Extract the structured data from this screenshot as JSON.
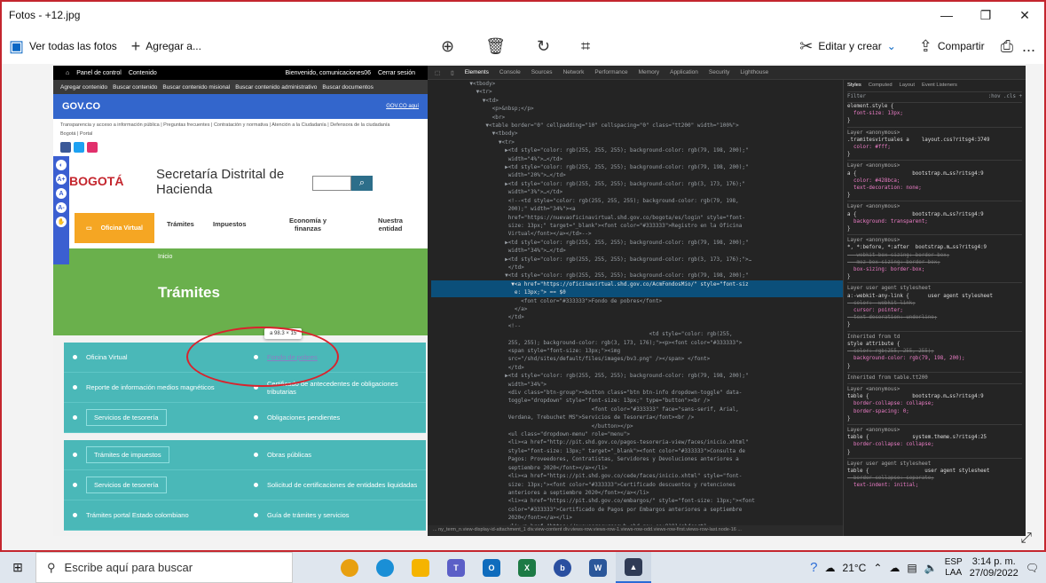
{
  "window": {
    "title": "Fotos - +12.jpg",
    "minimize": "—",
    "maximize": "❐",
    "close": "✕"
  },
  "toolbar": {
    "see_all": "Ver todas las fotos",
    "add": "Agregar a...",
    "edit": "Editar y crear",
    "share": "Compartir",
    "more": "..."
  },
  "site": {
    "topbar": {
      "panel": "Panel de control",
      "contenido": "Contenido",
      "welcome": "Bienvenido, comunicaciones06",
      "logout": "Cerrar sesión"
    },
    "menubar": [
      "Agregar contenido",
      "Buscar contenido",
      "Buscar contenido misional",
      "Buscar contenido administrativo",
      "Buscar documentos"
    ],
    "gov_logo": "GOV.CO",
    "gov_link": "GOV.CO aquí",
    "transparency": "Transparencia y acceso a información pública | Preguntas frecuentes | Contratación y normativa | Atención a la Ciudadanía | Defensora de la ciudadanía",
    "sub_links": "Bogotá | Portal",
    "logo": "BOGOTÁ",
    "secretaria_1": "Secretaría Distrital de",
    "secretaria_2": "Hacienda",
    "nav": {
      "oficina": "Oficina Virtual",
      "tramites": "Trámites",
      "impuestos": "Impuestos",
      "economia": "Economía y finanzas",
      "entidad": "Nuestra entidad"
    },
    "breadcrumb": "Inicio",
    "page_title": "Trámites",
    "tooltip": "a  98.3 × 15",
    "rows_top": [
      [
        "Oficina Virtual",
        "Fondo de pobres"
      ],
      [
        "Reporte de información medios magnéticos",
        "Certificado de antecedentes de obligaciones tributarias"
      ],
      [
        "Servicios de tesorería",
        "Obligaciones pendientes"
      ]
    ],
    "rows_bottom": [
      [
        "Trámites de impuestos",
        "Obras públicas"
      ],
      [
        "Servicios de tesorería",
        "Solicitud de certificaciones de entidades liquidadas"
      ],
      [
        "Trámites portal Estado colombiano",
        "Guía de trámites y servicios"
      ]
    ]
  },
  "devtools": {
    "tabs": [
      "Elements",
      "Console",
      "Sources",
      "Network",
      "Performance",
      "Memory",
      "Application",
      "Security",
      "Lighthouse"
    ],
    "code": [
      "            ▼<tbody>",
      "              ▼<tr>",
      "                ▼<td>",
      "                   <p>&nbsp;</p>",
      "                   <br>",
      "                 ▼<table border=\"0\" cellpadding=\"10\" cellspacing=\"0\" class=\"tt200\" width=\"100%\">",
      "                   ▼<tbody>",
      "                     ▼<tr>",
      "                       ▶<td style=\"color: rgb(255, 255, 255); background-color: rgb(79, 198, 200);\"",
      "                        width=\"4%\">…</td>",
      "                       ▶<td style=\"color: rgb(255, 255, 255); background-color: rgb(79, 198, 200);\"",
      "                        width=\"20%\">…</td>",
      "                       ▶<td style=\"color: rgb(255, 255, 255); background-color: rgb(3, 173, 176);\"",
      "                        width=\"3%\">…</td>",
      "                        <!--<td style=\"color: rgb(255, 255, 255); background-color: rgb(79, 198,",
      "                        200);\" width=\"34%\"><a",
      "                        href=\"https://nuevaoficinavirtual.shd.gov.co/bogota/es/login\" style=\"font-",
      "                        size: 13px;\" target=\"_blank\"><font color=\"#333333\">Registro en la Oficina",
      "                        Virtual</font></a></td>-->",
      "                       ▶<td style=\"color: rgb(255, 255, 255); background-color: rgb(79, 198, 200);\"",
      "                        width=\"34%\">…</td>",
      "                       ▶<td style=\"color: rgb(255, 255, 255); background-color: rgb(3, 173, 176);\">…",
      "                        </td>",
      "                       ▼<td style=\"color: rgb(255, 255, 255); background-color: rgb(79, 198, 200);\"",
      "                         ▼<a href=\"https://oficinavirtual.shd.gov.co/AcmFondosMio/\" style=\"font-siz",
      "                          e: 13px;\"> == $0",
      "                            <font color=\"#333333\">Fondo de pobres</font>",
      "                          </a>",
      "                        </td>",
      "                        <!--",
      "                                                                    <td style=\"color: rgb(255,",
      "                        255, 255); background-color: rgb(3, 173, 176);\"><p><font color=\"#333333\">",
      "                        <span style=\"font-size: 13px;\"><img",
      "                        src=\"/shd/sites/default/files/images/bv3.png\" /></span> </font>",
      "                        </td>",
      "                       ▶<td style=\"color: rgb(255, 255, 255); background-color: rgb(79, 198, 200);\"",
      "                        width=\"34%\">",
      "                        <div class=\"btn-group\"><button class=\"btn btn-info dropdown-toggle\" data-",
      "                        toggle=\"dropdown\" style=\"font-size: 13px;\" type=\"button\"><br />",
      "                                                  <font color=\"#333333\" face=\"sans-serif, Arial,",
      "                        Verdana, Trebuchet MS\">Servicios de Tesorería</font><br />",
      "                                                  </button></p>",
      "                        <ul class=\"dropdown-menu\" role=\"menu\">",
      "                        <li><a href=\"http://pit.shd.gov.co/pagos-tesoreria-view/faces/inicio.xhtml\"",
      "                        style=\"font-size: 13px;\" target=\"_blank\"><font color=\"#333333\">Consulta de",
      "                        Pagos: Proveedores, Contratistas, Servidores y Devoluciones anteriores a",
      "                        septiembre 2020</font></a></li>",
      "                        <li><a href=\"https://pit.shd.gov.co/cede/faces/inicio.xhtml\" style=\"font-",
      "                        size: 13px;\"><font color=\"#333333\">Certificado descuentos y retenciones",
      "                        anteriores a septiembre 2020</font></a></li>",
      "                        <li><a href=\"https://pit.shd.gov.co/embargos/\" style=\"font-size: 13px;\"><font",
      "                        color=\"#333333\">Certificado de Pagos por Embargos anteriores a septiembre",
      "                        2020</font></a></li>",
      "                        <li><a href=\"https://nuevosrecursoswb.shd.gov.co:8181/shdcert1-"
    ],
    "breadcrumb": "... ny_term_n.view-display-id-attachment_1   div.view-content   div.views-row.views-row-1.views-row-odd.views-row-first.views-row-last.node-16 ...",
    "styles_tabs": [
      "Styles",
      "Computed",
      "Layout",
      "Event Listeners"
    ],
    "filter": "Filter",
    "filter_tools": ":hov  .cls  +",
    "styles": [
      "element.style {",
      "  font-size: 13px;",
      "}",
      "Layer <anonymous>",
      ".tramitesvirtuales a    layout.css?ritsg4:3749",
      "  color: #fff;",
      "}",
      "Layer <anonymous>",
      "a {                  bootstrap.m…ss?ritsg4:9",
      "  color: #428bca;",
      "  text-decoration: none;",
      "}",
      "Layer <anonymous>",
      "a {                  bootstrap.m…ss?ritsg4:9",
      "  background: transparent;",
      "}",
      "Layer <anonymous>",
      "*, *:before, *:after  bootstrap.m…ss?ritsg4:9",
      "  -webkit-box-sizing: border-box;",
      "  -moz-box-sizing: border-box;",
      "  box-sizing: border-box;",
      "}",
      "Layer user agent stylesheet",
      "a:-webkit-any-link {      user agent stylesheet",
      "  color: -webkit-link;",
      "  cursor: pointer;",
      "  text-decoration: underline;",
      "}",
      "Inherited from td",
      "style attribute {",
      "  color: rgb(255, 255, 255);",
      "  background-color: rgb(79, 198, 200);",
      "}",
      "Inherited from table.tt200",
      "Layer <anonymous>",
      "table {              bootstrap.m…ss?ritsg4:9",
      "  border-collapse: collapse;",
      "  border-spacing: 0;",
      "}",
      "Layer <anonymous>",
      "table {              system.theme.s?ritsg4:25",
      "  border-collapse: collapse;",
      "}",
      "Layer user agent stylesheet",
      "table {                  user agent stylesheet",
      "  border-collapse: separate;",
      "  text-indent: initial;"
    ]
  },
  "taskbar": {
    "search_placeholder": "Escribe aquí para buscar",
    "weather": "21°C",
    "lang_1": "ESP",
    "lang_2": "LAA",
    "time": "3:14 p. m.",
    "date": "27/09/2022"
  }
}
